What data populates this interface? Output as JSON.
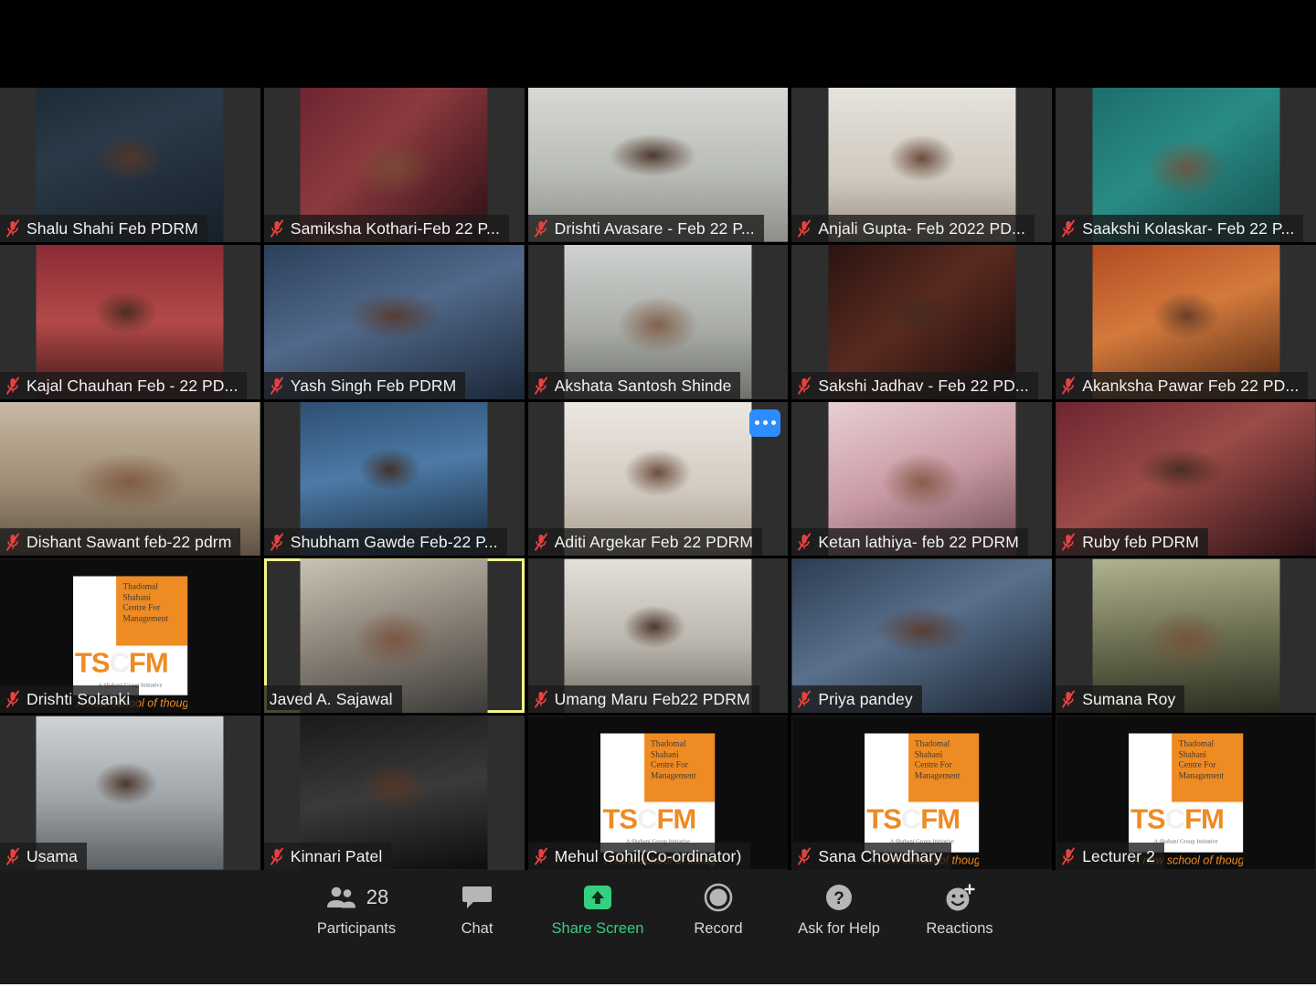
{
  "app": {
    "name": "Zoom Meeting",
    "view": "gallery"
  },
  "colors": {
    "accent_blue": "#2d8cff",
    "share_green": "#35d07f",
    "speaking_border": "#f4f48a",
    "mute_red": "#e8413f",
    "tile_bg": "#2e2e2e",
    "toolbar_bg": "#1b1b1b",
    "logo_orange": "#ee8b22"
  },
  "logo": {
    "line1": "Thadomal",
    "line2": "Shahani",
    "line3": "Centre For",
    "line4": "Management",
    "wordmark": "TSCFM",
    "initiative": "A Shahani Group Initiative",
    "tagline": "A new school of thought"
  },
  "gallery": {
    "rows": 5,
    "cols": 5,
    "participants": [
      {
        "name": "Shalu Shahi Feb PDRM",
        "muted": true,
        "speaking": false,
        "avatar": false
      },
      {
        "name": "Samiksha Kothari-Feb 22 P...",
        "muted": true,
        "speaking": false,
        "avatar": false
      },
      {
        "name": "Drishti Avasare - Feb 22 P...",
        "muted": true,
        "speaking": false,
        "avatar": false
      },
      {
        "name": "Anjali Gupta- Feb 2022 PD...",
        "muted": true,
        "speaking": false,
        "avatar": false
      },
      {
        "name": "Saakshi Kolaskar- Feb 22 P...",
        "muted": true,
        "speaking": false,
        "avatar": false
      },
      {
        "name": "Kajal Chauhan Feb - 22 PD...",
        "muted": true,
        "speaking": false,
        "avatar": false
      },
      {
        "name": "Yash Singh Feb PDRM",
        "muted": true,
        "speaking": false,
        "avatar": false
      },
      {
        "name": "Akshata Santosh Shinde",
        "muted": true,
        "speaking": false,
        "avatar": false
      },
      {
        "name": "Sakshi Jadhav - Feb 22 PD...",
        "muted": true,
        "speaking": false,
        "avatar": false
      },
      {
        "name": "Akanksha Pawar Feb 22 PD...",
        "muted": true,
        "speaking": false,
        "avatar": false
      },
      {
        "name": "Dishant Sawant feb-22 pdrm",
        "muted": true,
        "speaking": false,
        "avatar": false
      },
      {
        "name": "Shubham Gawde Feb-22 P...",
        "muted": true,
        "speaking": false,
        "avatar": false
      },
      {
        "name": "Aditi Argekar Feb 22 PDRM",
        "muted": true,
        "speaking": false,
        "avatar": false,
        "more_options": true
      },
      {
        "name": "Ketan lathiya- feb 22 PDRM",
        "muted": true,
        "speaking": false,
        "avatar": false
      },
      {
        "name": "Ruby feb PDRM",
        "muted": true,
        "speaking": false,
        "avatar": false
      },
      {
        "name": "Drishti Solanki",
        "muted": true,
        "speaking": false,
        "avatar": true
      },
      {
        "name": "Javed A. Sajawal",
        "muted": false,
        "speaking": true,
        "avatar": false
      },
      {
        "name": "Umang Maru Feb22 PDRM",
        "muted": true,
        "speaking": false,
        "avatar": false
      },
      {
        "name": "Priya pandey",
        "muted": true,
        "speaking": false,
        "avatar": false
      },
      {
        "name": "Sumana Roy",
        "muted": true,
        "speaking": false,
        "avatar": false
      },
      {
        "name": "Usama",
        "muted": true,
        "speaking": false,
        "avatar": false
      },
      {
        "name": "Kinnari Patel",
        "muted": true,
        "speaking": false,
        "avatar": false
      },
      {
        "name": "Mehul Gohil(Co-ordinator)",
        "muted": true,
        "speaking": false,
        "avatar": true
      },
      {
        "name": "Sana Chowdhary",
        "muted": true,
        "speaking": false,
        "avatar": true
      },
      {
        "name": "Lecturer 2",
        "muted": true,
        "speaking": false,
        "avatar": true
      }
    ]
  },
  "toolbar": {
    "participants_label": "Participants",
    "participants_count": "28",
    "chat_label": "Chat",
    "share_label": "Share Screen",
    "record_label": "Record",
    "help_label": "Ask for Help",
    "reactions_label": "Reactions"
  }
}
